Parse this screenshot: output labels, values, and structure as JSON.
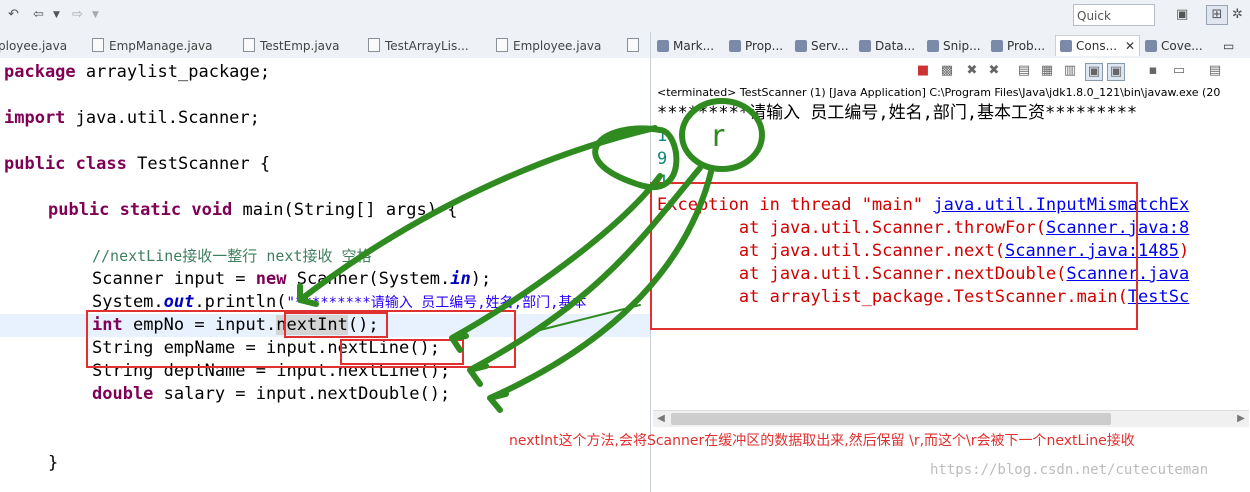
{
  "toolbar": {
    "quick_access": "Quick Access"
  },
  "editor_tabs": [
    "ployee.java",
    "EmpManage.java",
    "TestEmp.java",
    "TestArrayLis...",
    "Employee.java"
  ],
  "view_tabs": [
    "Mark...",
    "Prop...",
    "Serv...",
    "Data...",
    "Snip...",
    "Prob...",
    "Cons...",
    "Cove..."
  ],
  "code": {
    "l1_kw": "package",
    "l1_rest": " arraylist_package;",
    "l2_kw": "import",
    "l2_rest": " java.util.Scanner;",
    "l3_kw1": "public",
    "l3_kw2": "class",
    "l3_rest": " TestScanner {",
    "l4_kw1": "public",
    "l4_kw2": "static",
    "l4_kw3": "void",
    "l4_rest": " main(String[] args) {",
    "l5_comment": "//nextLine接收一整行 next接收 空格",
    "l6_a": "Scanner input = ",
    "l6_kw": "new",
    "l6_b": " Scanner(System.",
    "l6_in": "in",
    "l6_c": ");",
    "l7_a": "System.",
    "l7_out": "out",
    "l7_b": ".println(",
    "l7_str": "\"*********请输入 员工编号,姓名,部门,基本",
    "l8_kw": "int",
    "l8_a": " empNo = input.",
    "l8_sel": "nextInt",
    "l8_b": "();",
    "l9_a": "String empName = input.nextLine();",
    "l10_a": "String deptName = input.nextLine();",
    "l11_kw": "double",
    "l11_a": " salary = input.nextDouble();",
    "l12": "}"
  },
  "console": {
    "terminated": "<terminated> TestScanner (1) [Java Application] C:\\Program Files\\Java\\jdk1.8.0_121\\bin\\javaw.exe (20",
    "prompt": "*********请输入 员工编号,姓名,部门,基本工资*********",
    "in1": "1",
    "in2": "9",
    "in3": "4",
    "exc_a": "Exception in thread \"main\" ",
    "exc_link": "java.util.InputMismatchEx",
    "at1_a": "        at java.util.Scanner.throwFor(",
    "at1_link": "Scanner.java:8",
    "at2_a": "        at java.util.Scanner.next(",
    "at2_link": "Scanner.java:1485",
    "at2_b": ")",
    "at3_a": "        at java.util.Scanner.nextDouble(",
    "at3_link": "Scanner.java",
    "at4_a": "        at arraylist_package.TestScanner.main(",
    "at4_link": "TestSc"
  },
  "annotation": {
    "note": "nextInt这个方法,会将Scanner在缓冲区的数据取出来,然后保留 \\r,而这个\\r会被下一个nextLine接收",
    "drawn_r": "r",
    "color": "#e03030",
    "ink": "#2f8a1f"
  },
  "watermark": "https://blog.csdn.net/cutecuteman"
}
